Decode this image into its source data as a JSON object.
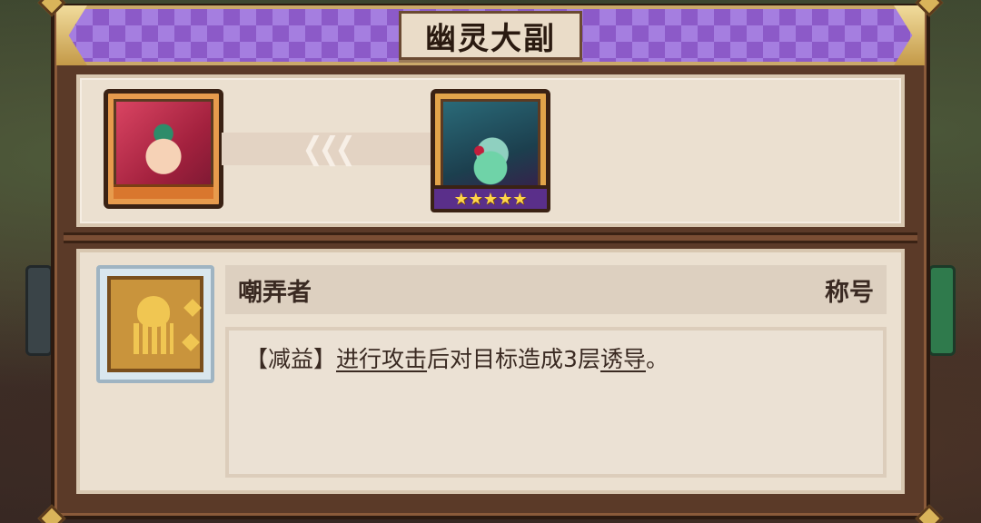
{
  "header": {
    "title": "幽灵大副"
  },
  "transfer": {
    "arrow_glyph": "❮❮❮",
    "from_character": {
      "name": "red-haired-hero-portrait"
    },
    "to_character": {
      "name": "ghost-mate-portrait",
      "stars": "★★★★★",
      "star_count": 5
    }
  },
  "skill": {
    "name": "嘲弄者",
    "type": "称号",
    "icon": "taunt-skill-icon",
    "desc_tag": "【减益】",
    "desc_kw1": "进行攻击",
    "desc_mid": "后对目标造成3层",
    "desc_kw2": "诱导",
    "desc_end": "。"
  },
  "colors": {
    "header_purple": "#8c5ac8",
    "frame_brown": "#5b3a28",
    "panel_cream": "#ebe0d0",
    "star_gold": "#ffd54a"
  }
}
